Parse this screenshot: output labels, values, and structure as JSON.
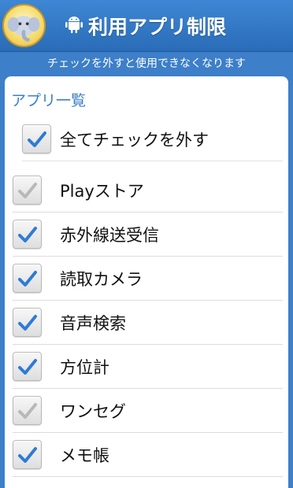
{
  "header": {
    "title": "利用アプリ制限",
    "logo_icon": "elephant-logo-icon",
    "title_icon": "android-icon"
  },
  "subtitle": "チェックを外すと使用できなくなります",
  "list": {
    "header": "アプリ一覧",
    "select_all": {
      "label": "全てチェックを外す",
      "checked": true
    },
    "items": [
      {
        "label": "Playストア",
        "checked": true,
        "disabled": true
      },
      {
        "label": "赤外線送受信",
        "checked": true,
        "disabled": false
      },
      {
        "label": "読取カメラ",
        "checked": true,
        "disabled": false
      },
      {
        "label": "音声検索",
        "checked": true,
        "disabled": false
      },
      {
        "label": "方位計",
        "checked": true,
        "disabled": false
      },
      {
        "label": "ワンセグ",
        "checked": true,
        "disabled": true
      },
      {
        "label": "メモ帳",
        "checked": true,
        "disabled": false
      }
    ]
  },
  "colors": {
    "accent": "#3d7fc8",
    "check_active": "#2e7bd6",
    "check_disabled": "#b8b8b8"
  }
}
